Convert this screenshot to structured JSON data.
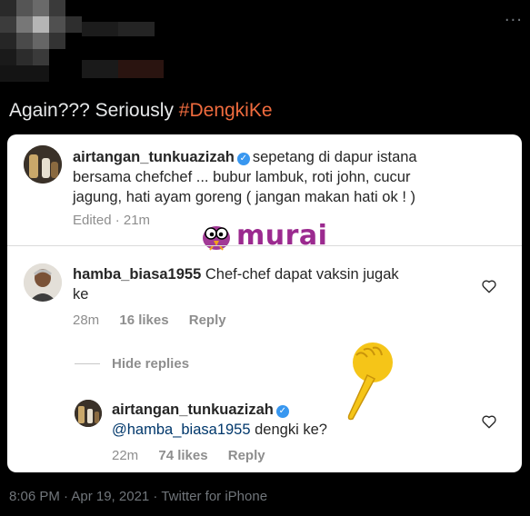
{
  "tweet": {
    "text": "Again??? Seriously ",
    "hashtag": "#DengkiKe",
    "timestamp": "8:06 PM · Apr 19, 2021 · Twitter for iPhone",
    "more_icon": "more-dots-icon"
  },
  "embedded_post": {
    "logo_text": "murai",
    "caption": {
      "username": "airtangan_tunkuazizah",
      "text_line1": "sepetang di dapur istana",
      "text_line2": "bersama chefchef ... bubur lambuk, roti john, cucur",
      "text_line3": "jagung, hati ayam goreng ( jangan makan hati ok ! )",
      "meta": "Edited · 21m"
    },
    "comment": {
      "username": "hamba_biasa1955",
      "text_line1": "Chef-chef dapat vaksin jugak",
      "text_line2": "ke",
      "time": "28m",
      "likes": "16 likes",
      "reply": "Reply"
    },
    "hide_replies": "Hide replies",
    "reply": {
      "username": "airtangan_tunkuazizah",
      "mention": "@hamba_biasa1955",
      "text": " dengki ke?",
      "time": "22m",
      "likes": "74 likes",
      "reply": "Reply"
    }
  }
}
